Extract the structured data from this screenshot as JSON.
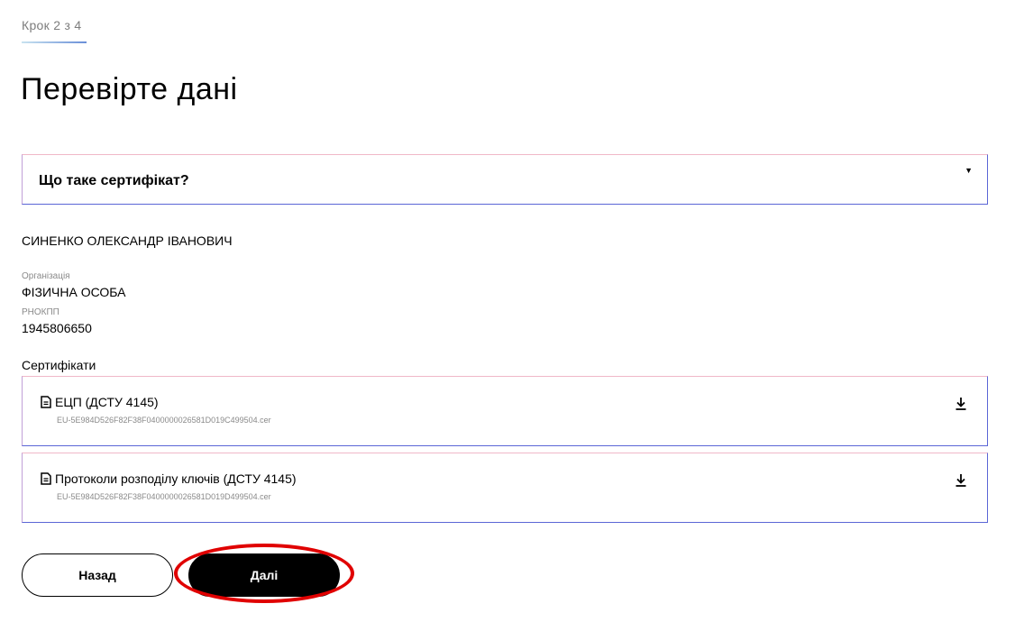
{
  "step": "Крок 2 з 4",
  "title": "Перевірте дані",
  "accordion": {
    "title": "Що таке сертифікат?",
    "arrow_icon": "caret-down-icon"
  },
  "person": {
    "full_name": "СИНЕНКО ОЛЕКСАНДР ІВАНОВИЧ",
    "organization_label": "Організація",
    "organization_value": "ФІЗИЧНА ОСОБА",
    "rnokpp_label": "РНОКПП",
    "rnokpp_value": "1945806650"
  },
  "certificates": {
    "label": "Сертифікати",
    "items": [
      {
        "icon": "document-icon",
        "title": "ЕЦП (ДСТУ 4145)",
        "file": "EU-5E984D526F82F38F0400000026581D019C499504.cer",
        "action_icon": "download-icon"
      },
      {
        "icon": "document-icon",
        "title": "Протоколи розподілу ключів (ДСТУ 4145)",
        "file": "EU-5E984D526F82F38F0400000026581D019D499504.cer",
        "action_icon": "download-icon"
      }
    ]
  },
  "buttons": {
    "back": "Назад",
    "next": "Далі"
  },
  "colors": {
    "highlight": "#e00000",
    "border_accent": "#5b66d6",
    "border_top": "#f0b8c8"
  }
}
